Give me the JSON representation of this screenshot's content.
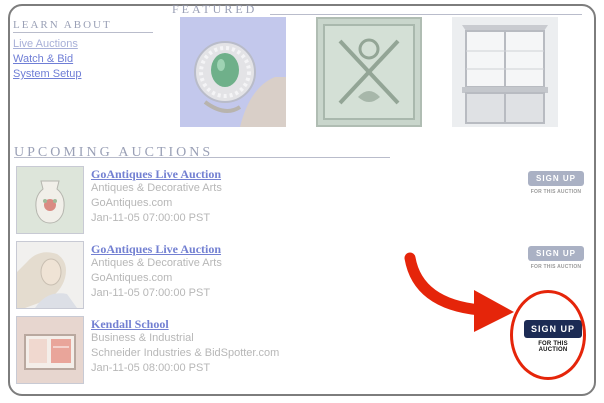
{
  "learn_about": {
    "heading": "LEARN ABOUT",
    "links": [
      "Live Auctions",
      "Watch & Bid",
      "System Setup"
    ]
  },
  "featured": {
    "heading": "FEATURED",
    "items": [
      "ring-photo",
      "crossed-swords-plate-photo",
      "china-cabinet-photo"
    ]
  },
  "upcoming": {
    "heading": "UPCOMING AUCTIONS",
    "rows": [
      {
        "title": "GoAntiques Live Auction",
        "category": "Antiques & Decorative Arts",
        "seller": "GoAntiques.com",
        "date": "Jan-11-05 07:00:00 PST",
        "button": "SIGN UP",
        "button_sub": "FOR THIS AUCTION"
      },
      {
        "title": "GoAntiques Live Auction",
        "category": "Antiques & Decorative Arts",
        "seller": "GoAntiques.com",
        "date": "Jan-11-05 07:00:00 PST",
        "button": "SIGN UP",
        "button_sub": "FOR THIS AUCTION"
      },
      {
        "title": "Kendall School",
        "category": "Business & Industrial",
        "seller": "Schneider Industries & BidSpotter.com",
        "date": "Jan-11-05 08:00:00 PST",
        "button": "SIGN UP",
        "button_sub": "FOR THIS AUCTION"
      }
    ]
  },
  "colors": {
    "accent_red": "#e5250a",
    "active_button": "#1c2b54",
    "link": "#7380d2"
  }
}
